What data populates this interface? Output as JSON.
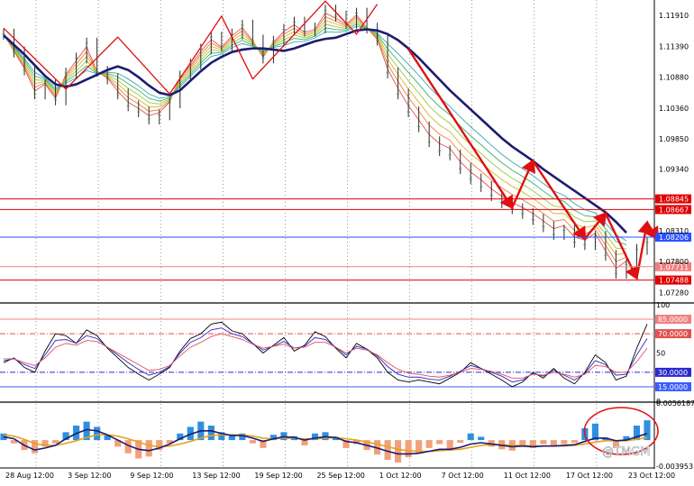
{
  "watermark": "@TMGM",
  "chart_data": [
    {
      "type": "line",
      "panel": "price",
      "y_ticks": [
        "1.11910",
        "1.11390",
        "1.10880",
        "1.10360",
        "1.09850",
        "1.09340",
        "1.08310",
        "1.07800",
        "1.07280"
      ],
      "ylim": [
        1.0712,
        1.1217
      ],
      "grid": "dotted vertical",
      "levels": [
        {
          "value": "1.08845",
          "num": 1.08845,
          "style": "solid",
          "badge": true,
          "color": "#e00000"
        },
        {
          "value": "1.08667",
          "num": 1.08667,
          "style": "solid",
          "badge": true,
          "color": "#e00000"
        },
        {
          "value": "1.08206",
          "num": 1.08206,
          "style": "solid",
          "badge": true,
          "color": "#2a4fff"
        },
        {
          "value": "1.07711",
          "num": 1.07711,
          "style": "solid",
          "badge": true,
          "color": "#f08080"
        },
        {
          "value": "1.07488",
          "num": 1.07488,
          "style": "solid",
          "badge": true,
          "color": "#e00000"
        }
      ],
      "ma_main_color": "#1c1c6e",
      "ma_main": [
        1.1158,
        1.1142,
        1.1126,
        1.1108,
        1.109,
        1.1076,
        1.1072,
        1.1076,
        1.1084,
        1.1092,
        1.11,
        1.1106,
        1.11,
        1.1088,
        1.1074,
        1.1062,
        1.1058,
        1.1066,
        1.1082,
        1.1098,
        1.1112,
        1.1122,
        1.113,
        1.1134,
        1.1136,
        1.1136,
        1.1134,
        1.1132,
        1.1136,
        1.1142,
        1.1148,
        1.1152,
        1.1154,
        1.116,
        1.1166,
        1.1168,
        1.1166,
        1.116,
        1.115,
        1.1136,
        1.112,
        1.1102,
        1.1084,
        1.1066,
        1.105,
        1.1034,
        1.1018,
        1.1002,
        1.0986,
        1.0972,
        1.096,
        1.0948,
        1.0934,
        1.0922,
        1.091,
        1.0898,
        1.0886,
        1.0874,
        1.0862,
        1.0846,
        1.0828
      ],
      "ma_fan_colors": [
        "#e25050",
        "#e8803a",
        "#d9b22f",
        "#9ac93a",
        "#3db06a",
        "#3aa7b0"
      ],
      "ma_fan_offsets": [
        0.001,
        0.002,
        0.003,
        0.004,
        0.005,
        0.006
      ],
      "zigzag": [
        [
          0,
          1.117
        ],
        [
          6,
          1.1068
        ],
        [
          11,
          1.1155
        ],
        [
          16,
          1.106
        ],
        [
          21,
          1.119
        ],
        [
          24,
          1.1085
        ],
        [
          31,
          1.1215
        ],
        [
          34,
          1.116
        ],
        [
          36,
          1.121
        ]
      ],
      "arrows": [
        [
          [
            39,
            1.1135
          ],
          [
            49,
            1.087
          ]
        ],
        [
          [
            49,
            1.087
          ],
          [
            51,
            1.0948
          ]
        ],
        [
          [
            51,
            1.0948
          ],
          [
            56,
            1.0818
          ]
        ],
        [
          [
            56,
            1.0818
          ],
          [
            58,
            1.086
          ]
        ],
        [
          [
            58,
            1.086
          ],
          [
            61,
            1.0752
          ]
        ],
        [
          [
            61,
            1.0752
          ],
          [
            62,
            1.0845
          ]
        ],
        [
          [
            62,
            1.0845
          ],
          [
            63,
            1.0818
          ]
        ]
      ],
      "close": [
        1.116,
        1.113,
        1.11,
        1.106,
        1.1075,
        1.105,
        1.1095,
        1.112,
        1.1145,
        1.1098,
        1.1085,
        1.106,
        1.104,
        1.103,
        1.1018,
        1.1025,
        1.1045,
        1.109,
        1.111,
        1.1135,
        1.1155,
        1.114,
        1.116,
        1.1175,
        1.115,
        1.112,
        1.1148,
        1.1168,
        1.118,
        1.1165,
        1.117,
        1.12,
        1.119,
        1.1178,
        1.1195,
        1.117,
        1.115,
        1.1095,
        1.106,
        1.103,
        1.1005,
        1.098,
        1.0965,
        1.0958,
        1.0935,
        1.0918,
        1.0905,
        1.089,
        1.0878,
        1.0868,
        1.086,
        1.085,
        1.0838,
        1.0825,
        1.0832,
        1.0812,
        1.0808,
        1.0822,
        1.079,
        1.076,
        1.0775,
        1.08,
        1.0812
      ]
    },
    {
      "type": "line",
      "panel": "oscillator",
      "y_ticks": [
        "100",
        "85.0000",
        "70.0000",
        "50",
        "30.0000",
        "15.0000",
        "0"
      ],
      "ylim": [
        0,
        100
      ],
      "levels": [
        {
          "value": "85.0000",
          "num": 85,
          "color": "#f08080",
          "style": "solid",
          "badge": true
        },
        {
          "value": "70.0000",
          "num": 70,
          "color": "#e25050",
          "style": "dashdot",
          "badge": true
        },
        {
          "value": "30.0000",
          "num": 30,
          "color": "#2a2acc",
          "style": "dashdot",
          "badge": true
        },
        {
          "value": "15.0000",
          "num": 15,
          "color": "#3a5cff",
          "style": "solid",
          "badge": true
        }
      ],
      "series": [
        {
          "color": "#000000",
          "values": [
            40,
            45,
            35,
            30,
            52,
            70,
            68,
            60,
            74,
            68,
            55,
            45,
            35,
            28,
            22,
            28,
            35,
            52,
            65,
            70,
            80,
            82,
            73,
            70,
            60,
            50,
            58,
            66,
            52,
            58,
            72,
            67,
            55,
            45,
            60,
            54,
            45,
            30,
            22,
            20,
            22,
            20,
            18,
            24,
            30,
            40,
            34,
            28,
            22,
            15,
            20,
            30,
            24,
            34,
            24,
            18,
            30,
            48,
            40,
            22,
            26,
            55,
            80
          ]
        },
        {
          "color": "#2a2acc",
          "values": [
            42,
            44,
            38,
            34,
            48,
            63,
            64,
            60,
            68,
            65,
            56,
            48,
            40,
            33,
            27,
            30,
            36,
            50,
            61,
            66,
            74,
            76,
            70,
            67,
            60,
            53,
            57,
            62,
            55,
            57,
            66,
            64,
            56,
            48,
            57,
            54,
            47,
            36,
            28,
            25,
            25,
            23,
            22,
            26,
            31,
            37,
            34,
            30,
            26,
            20,
            22,
            29,
            26,
            32,
            27,
            22,
            29,
            42,
            38,
            27,
            28,
            48,
            65
          ]
        },
        {
          "color": "#e25050",
          "values": [
            44,
            44,
            40,
            37,
            45,
            56,
            60,
            58,
            63,
            62,
            56,
            50,
            44,
            38,
            32,
            33,
            37,
            47,
            56,
            61,
            67,
            70,
            67,
            64,
            59,
            55,
            57,
            59,
            55,
            56,
            61,
            61,
            56,
            50,
            55,
            53,
            48,
            40,
            33,
            29,
            28,
            26,
            25,
            27,
            30,
            34,
            33,
            31,
            28,
            24,
            24,
            28,
            27,
            30,
            28,
            25,
            28,
            37,
            36,
            30,
            30,
            41,
            55
          ]
        }
      ]
    },
    {
      "type": "bar",
      "panel": "histogram",
      "y_ticks": [
        "0.0056187",
        "-0.003953"
      ],
      "ylim": [
        -0.003953,
        0.0056187
      ],
      "colors": {
        "positive": "#2e8fe0",
        "negative": "#f2a07a",
        "line_a": "#1c1c6e",
        "line_b": "#e8a020"
      },
      "values": [
        0.001,
        -0.0005,
        -0.0015,
        -0.002,
        -0.001,
        -0.0005,
        0.0012,
        0.0022,
        0.0028,
        0.002,
        0.0008,
        -0.001,
        -0.002,
        -0.0028,
        -0.0025,
        -0.0015,
        -0.0005,
        0.001,
        0.002,
        0.0028,
        0.0022,
        0.0012,
        0.0008,
        0.001,
        -0.0005,
        -0.0012,
        0.0008,
        0.0012,
        0.0006,
        -0.0008,
        0.001,
        0.0012,
        0.0005,
        -0.0012,
        -0.0006,
        -0.0015,
        -0.0022,
        -0.003,
        -0.0034,
        -0.0026,
        -0.002,
        -0.0012,
        -0.0006,
        -0.0016,
        -0.0004,
        0.001,
        0.0005,
        -0.001,
        -0.0014,
        -0.0016,
        -0.0008,
        -0.0012,
        -0.0006,
        -0.001,
        -0.0006,
        -0.0004,
        0.0018,
        0.0025,
        0.0004,
        -0.0012,
        0.0006,
        0.0022,
        0.003
      ],
      "line_a": [
        0.0005,
        0.0002,
        -0.0008,
        -0.0015,
        -0.0012,
        -0.0008,
        0.0002,
        0.001,
        0.0016,
        0.0014,
        0.0008,
        0.0,
        -0.0008,
        -0.0014,
        -0.0016,
        -0.0012,
        -0.0006,
        0.0002,
        0.0009,
        0.0014,
        0.0014,
        0.001,
        0.0007,
        0.0007,
        0.0003,
        -0.0002,
        0.0002,
        0.0005,
        0.0004,
        0.0,
        0.0003,
        0.0005,
        0.0004,
        -0.0002,
        -0.0004,
        -0.0008,
        -0.0012,
        -0.0017,
        -0.0021,
        -0.0021,
        -0.002,
        -0.0017,
        -0.0014,
        -0.0014,
        -0.0011,
        -0.0006,
        -0.0004,
        -0.0006,
        -0.0008,
        -0.001,
        -0.0009,
        -0.001,
        -0.0009,
        -0.0009,
        -0.0008,
        -0.0007,
        -0.0002,
        0.0003,
        0.0003,
        -0.0001,
        0.0,
        0.0005,
        0.001
      ],
      "line_b": [
        0.0008,
        0.0006,
        0.0001,
        -0.0005,
        -0.0008,
        -0.0008,
        -0.0005,
        -0.0001,
        0.0004,
        0.0008,
        0.0008,
        0.0006,
        0.0002,
        -0.0003,
        -0.0008,
        -0.001,
        -0.0009,
        -0.0006,
        -0.0002,
        0.0003,
        0.0007,
        0.0008,
        0.0008,
        0.0008,
        0.0006,
        0.0003,
        0.0002,
        0.0003,
        0.0003,
        0.0002,
        0.0002,
        0.0003,
        0.0004,
        0.0002,
        0.0,
        -0.0003,
        -0.0006,
        -0.001,
        -0.0014,
        -0.0016,
        -0.0017,
        -0.0017,
        -0.0016,
        -0.0015,
        -0.0014,
        -0.0011,
        -0.0008,
        -0.0007,
        -0.0007,
        -0.0008,
        -0.0008,
        -0.0009,
        -0.0009,
        -0.0009,
        -0.0009,
        -0.0008,
        -0.0006,
        -0.0003,
        -0.0001,
        -0.0001,
        -0.0001,
        0.0001,
        0.0004
      ],
      "highlight_circle": {
        "from_index": 57,
        "to_index": 62
      }
    }
  ],
  "x_axis": {
    "labels": [
      "28 Aug 12:00",
      "3 Sep 12:00",
      "9 Sep 12:00",
      "13 Sep 12:00",
      "19 Sep 12:00",
      "25 Sep 12:00",
      "1 Oct 12:00",
      "7 Oct 12:00",
      "11 Oct 12:00",
      "17 Oct 12:00",
      "23 Oct 12:00"
    ],
    "label_index": [
      0,
      6,
      12,
      18,
      24,
      30,
      36,
      42,
      48,
      54,
      60
    ]
  }
}
